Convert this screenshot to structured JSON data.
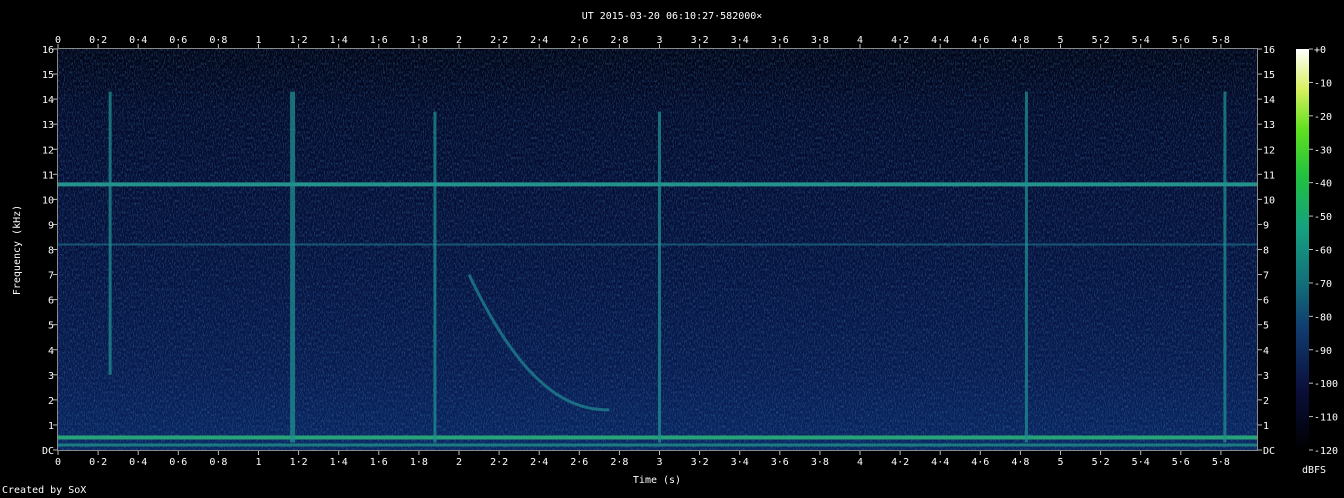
{
  "chart_data": {
    "type": "heatmap",
    "title": "UT 2015-03-20 06:10:27·582000×",
    "xlabel": "Time (s)",
    "ylabel": "Frequency (kHz)",
    "xlim": [
      0,
      5.98
    ],
    "ylim": [
      0,
      16
    ],
    "x_ticks": [
      "0",
      "0·2",
      "0·4",
      "0·6",
      "0·8",
      "1",
      "1·2",
      "1·4",
      "1·6",
      "1·8",
      "2",
      "2·2",
      "2·4",
      "2·6",
      "2·8",
      "3",
      "3·2",
      "3·4",
      "3·6",
      "3·8",
      "4",
      "4·2",
      "4·4",
      "4·6",
      "4·8",
      "5",
      "5·2",
      "5·4",
      "5·6",
      "5·8"
    ],
    "y_ticks": [
      "DC",
      "1",
      "2",
      "3",
      "4",
      "5",
      "6",
      "7",
      "8",
      "9",
      "10",
      "11",
      "12",
      "13",
      "14",
      "15",
      "16"
    ],
    "colorbar": {
      "label": "dBFS",
      "ticks": [
        "+0",
        "-10",
        "-20",
        "-30",
        "-40",
        "-50",
        "-60",
        "-70",
        "-80",
        "-90",
        "-100",
        "-110",
        "-120"
      ],
      "range": [
        -120,
        0
      ]
    },
    "features": {
      "horizontal_lines_khz": [
        10.6,
        8.2,
        0.5,
        0.2
      ],
      "vertical_impulses_s": [
        0.26,
        1.17,
        1.88,
        3.0,
        4.83,
        5.82
      ],
      "whistler_sweep": {
        "start_s": 2.05,
        "end_s": 2.75,
        "start_khz": 7.0,
        "end_khz": 1.6
      }
    }
  },
  "footer": {
    "credit": "Created by SoX"
  }
}
